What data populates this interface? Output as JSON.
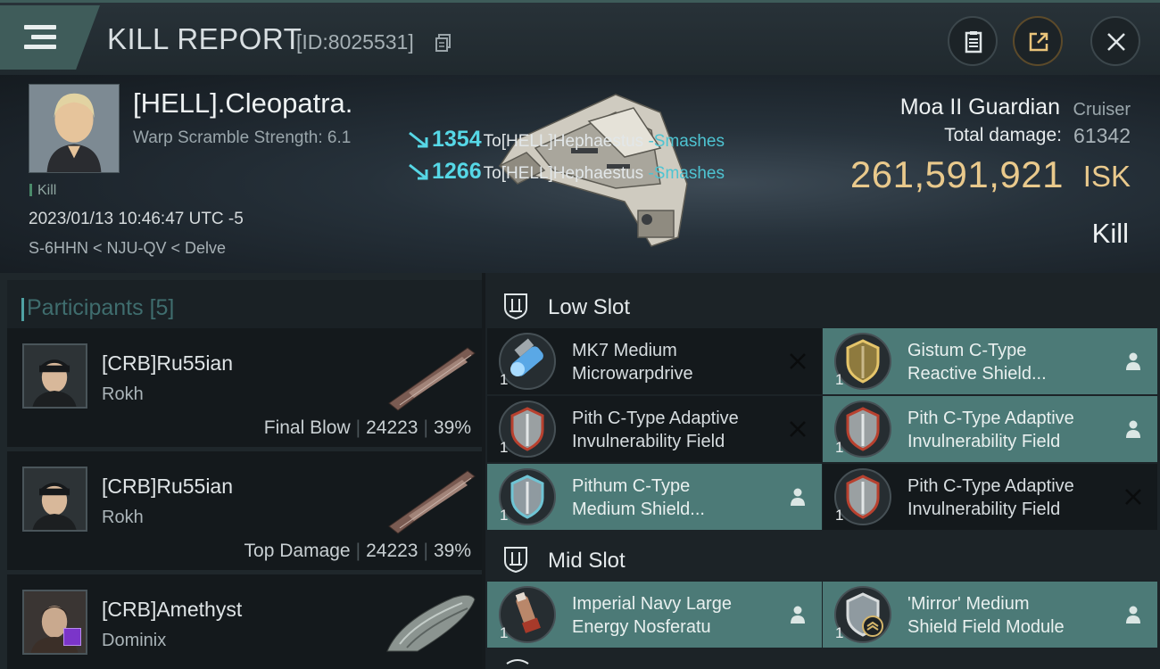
{
  "header": {
    "title": "KILL REPORT",
    "report_id": "[ID:8025531]",
    "icons": {
      "menu": "menu-icon",
      "copy": "copy-icon",
      "clipboard": "clipboard-icon",
      "share": "share-icon",
      "close": "close-icon"
    }
  },
  "victim": {
    "name": "[HELL].Cleopatra.",
    "warp_scramble": "Warp Scramble Strength: 6.1",
    "kill_tag": "Kill",
    "datetime": "2023/01/13 10:46:47 UTC -5",
    "location": "S-6HHN < NJU-QV < Delve"
  },
  "damage_events": [
    {
      "amount": "1354",
      "target": "To[HELL]Hephaestus",
      "type": "-Smashes"
    },
    {
      "amount": "1266",
      "target": "To[HELL]Hephaestus",
      "type": "-Smashes"
    }
  ],
  "ship": {
    "name": "Moa II Guardian",
    "class": "Cruiser",
    "total_damage_label": "Total damage:",
    "total_damage": "61342",
    "isk_value": "261,591,921",
    "isk_unit": "ISK",
    "result": "Kill"
  },
  "participants": {
    "title": "Participants",
    "count": "[5]",
    "items": [
      {
        "name": "[CRB]Ru55ian",
        "ship": "Rokh",
        "role": "Final Blow",
        "damage": "24223",
        "percent": "39%"
      },
      {
        "name": "[CRB]Ru55ian",
        "ship": "Rokh",
        "role": "Top Damage",
        "damage": "24223",
        "percent": "39%"
      },
      {
        "name": "[CRB]Amethyst",
        "ship": "Dominix",
        "role": "",
        "damage": "",
        "percent": ""
      }
    ]
  },
  "slots": {
    "low": {
      "label": "Low Slot",
      "modules": [
        {
          "name_l1": "MK7 Medium",
          "name_l2": "Microwarpdrive",
          "qty": "1",
          "status": "destroyed",
          "icon": "microwarpdrive-icon"
        },
        {
          "name_l1": "Gistum C-Type",
          "name_l2": "Reactive Shield...",
          "qty": "1",
          "status": "dropped",
          "icon": "gold-shield-icon"
        },
        {
          "name_l1": "Pith C-Type Adaptive",
          "name_l2": "Invulnerability Field",
          "qty": "1",
          "status": "destroyed",
          "icon": "red-shield-icon"
        },
        {
          "name_l1": "Pith C-Type Adaptive",
          "name_l2": "Invulnerability Field",
          "qty": "1",
          "status": "dropped",
          "icon": "red-shield-icon"
        },
        {
          "name_l1": "Pithum C-Type",
          "name_l2": "Medium Shield...",
          "qty": "1",
          "status": "dropped",
          "icon": "blue-shield-icon"
        },
        {
          "name_l1": "Pith C-Type Adaptive",
          "name_l2": "Invulnerability Field",
          "qty": "1",
          "status": "destroyed",
          "icon": "red-shield-icon"
        }
      ]
    },
    "mid": {
      "label": "Mid Slot",
      "modules": [
        {
          "name_l1": "Imperial Navy Large",
          "name_l2": "Energy Nosferatu",
          "qty": "1",
          "status": "dropped",
          "icon": "nosferatu-icon"
        },
        {
          "name_l1": "'Mirror' Medium",
          "name_l2": "Shield Field Module",
          "qty": "1",
          "status": "dropped",
          "icon": "shield-module-icon"
        }
      ]
    }
  },
  "colors": {
    "accent": "#4c7a77",
    "isk_gold": "#e9c98c",
    "damage_cyan": "#56d7e6"
  }
}
